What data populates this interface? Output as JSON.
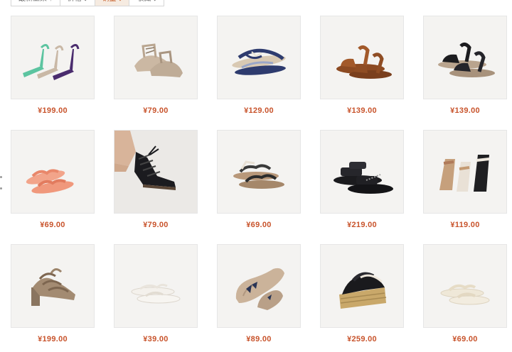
{
  "sort_tabs": [
    {
      "label": "最新上架 ↑",
      "active": false
    },
    {
      "label": "价格 ↕",
      "active": false
    },
    {
      "label": "销量 ↓",
      "active": true
    },
    {
      "label": "收藏 ↓",
      "active": false
    }
  ],
  "products": [
    {
      "price": "¥199.00",
      "image": "strappy-heel-sandals-icon"
    },
    {
      "price": "¥79.00",
      "image": "lace-up-flat-sandal-icon"
    },
    {
      "price": "¥129.00",
      "image": "beaded-thong-sandal-icon"
    },
    {
      "price": "¥139.00",
      "image": "brown-ankle-strap-sandal-icon"
    },
    {
      "price": "¥139.00",
      "image": "black-ankle-strap-sandal-icon"
    },
    {
      "price": "¥69.00",
      "image": "pink-jelly-flip-flop-icon"
    },
    {
      "price": "¥79.00",
      "image": "black-lace-up-gladiator-icon"
    },
    {
      "price": "¥69.00",
      "image": "braided-flat-sandal-icon"
    },
    {
      "price": "¥219.00",
      "image": "black-sport-sandal-icon"
    },
    {
      "price": "¥119.00",
      "image": "wedge-sandal-trio-icon"
    },
    {
      "price": "¥199.00",
      "image": "caged-block-heel-icon"
    },
    {
      "price": "¥39.00",
      "image": "white-thong-sandal-icon"
    },
    {
      "price": "¥89.00",
      "image": "bow-ballet-flat-icon"
    },
    {
      "price": "¥259.00",
      "image": "espadrille-wedge-icon"
    },
    {
      "price": "¥69.00",
      "image": "cream-slide-sandal-icon"
    }
  ]
}
